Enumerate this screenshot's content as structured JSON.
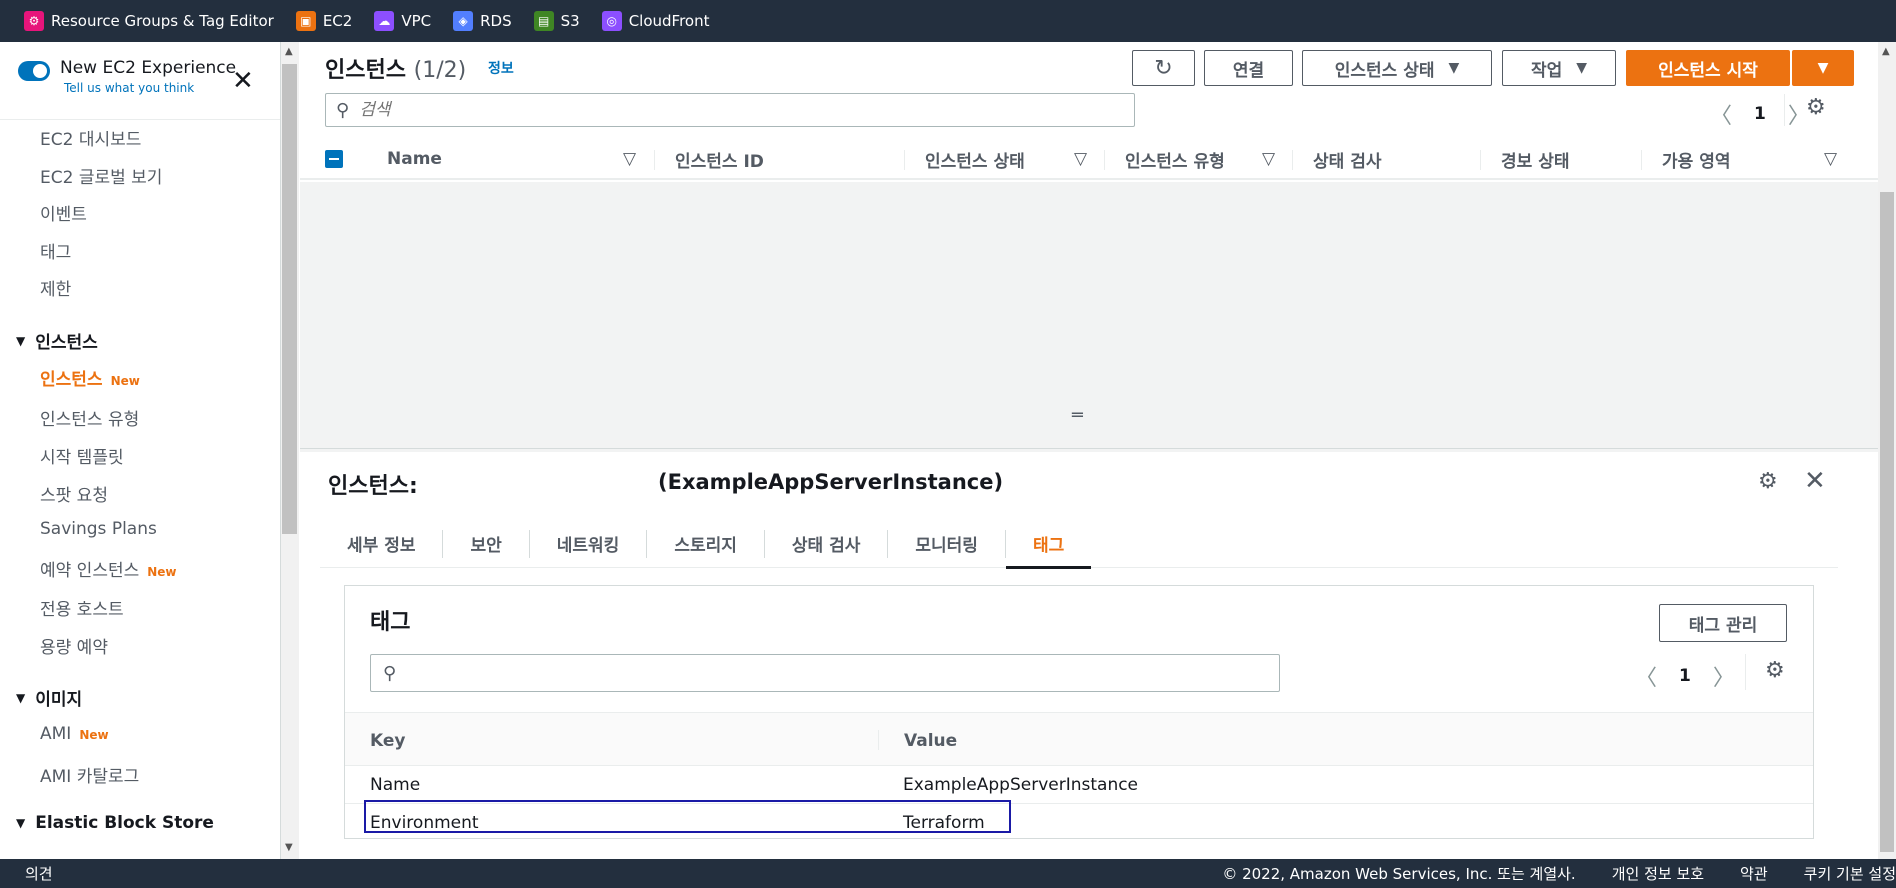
{
  "favorites": [
    {
      "label": "Resource Groups & Tag Editor",
      "icon": "resource-groups-icon",
      "color": "#e7157b"
    },
    {
      "label": "EC2",
      "icon": "ec2-icon",
      "color": "#ec7211"
    },
    {
      "label": "VPC",
      "icon": "vpc-icon",
      "color": "#8c4fff"
    },
    {
      "label": "RDS",
      "icon": "rds-icon",
      "color": "#527fff"
    },
    {
      "label": "S3",
      "icon": "s3-icon",
      "color": "#3f8624"
    },
    {
      "label": "CloudFront",
      "icon": "cloudfront-icon",
      "color": "#8c4fff"
    }
  ],
  "sidebar": {
    "toggle_label": "New EC2 Experience",
    "toggle_sub": "Tell us what you think",
    "items": [
      "EC2 대시보드",
      "EC2 글로벌 보기",
      "이벤트",
      "태그",
      "제한"
    ],
    "section_instances": "인스턴스",
    "instances_items": [
      "인스턴스",
      "인스턴스 유형",
      "시작 템플릿",
      "스팟 요청",
      "Savings Plans",
      "예약 인스턴스",
      "전용 호스트",
      "용량 예약"
    ],
    "new_badge": "New",
    "section_images": "이미지",
    "images_items": [
      "AMI",
      "AMI 카탈로그"
    ],
    "section_ebs": "Elastic Block Store"
  },
  "header": {
    "title": "인스턴스",
    "count": "(1/2)",
    "info": "정보",
    "btn_connect": "연결",
    "btn_state": "인스턴스 상태",
    "btn_actions": "작업",
    "btn_launch": "인스턴스 시작",
    "search_placeholder": "검색",
    "page": "1"
  },
  "columns": [
    "Name",
    "인스턴스 ID",
    "인스턴스 상태",
    "인스턴스 유형",
    "상태 검사",
    "경보 상태",
    "가용 영역"
  ],
  "detail": {
    "title": "인스턴스:",
    "name": "(ExampleAppServerInstance)",
    "tabs": [
      "세부 정보",
      "보안",
      "네트워킹",
      "스토리지",
      "상태 검사",
      "모니터링",
      "태그"
    ],
    "tags_title": "태그",
    "manage_btn": "태그 관리",
    "page": "1",
    "col_key": "Key",
    "col_value": "Value",
    "rows": [
      {
        "key": "Name",
        "value": "ExampleAppServerInstance"
      },
      {
        "key": "Environment",
        "value": "Terraform"
      }
    ]
  },
  "footer": {
    "feedback": "의견",
    "copyright": "© 2022, Amazon Web Services, Inc. 또는 계열사.",
    "privacy": "개인 정보 보호",
    "terms": "약관",
    "cookies": "쿠키 기본 설정"
  }
}
